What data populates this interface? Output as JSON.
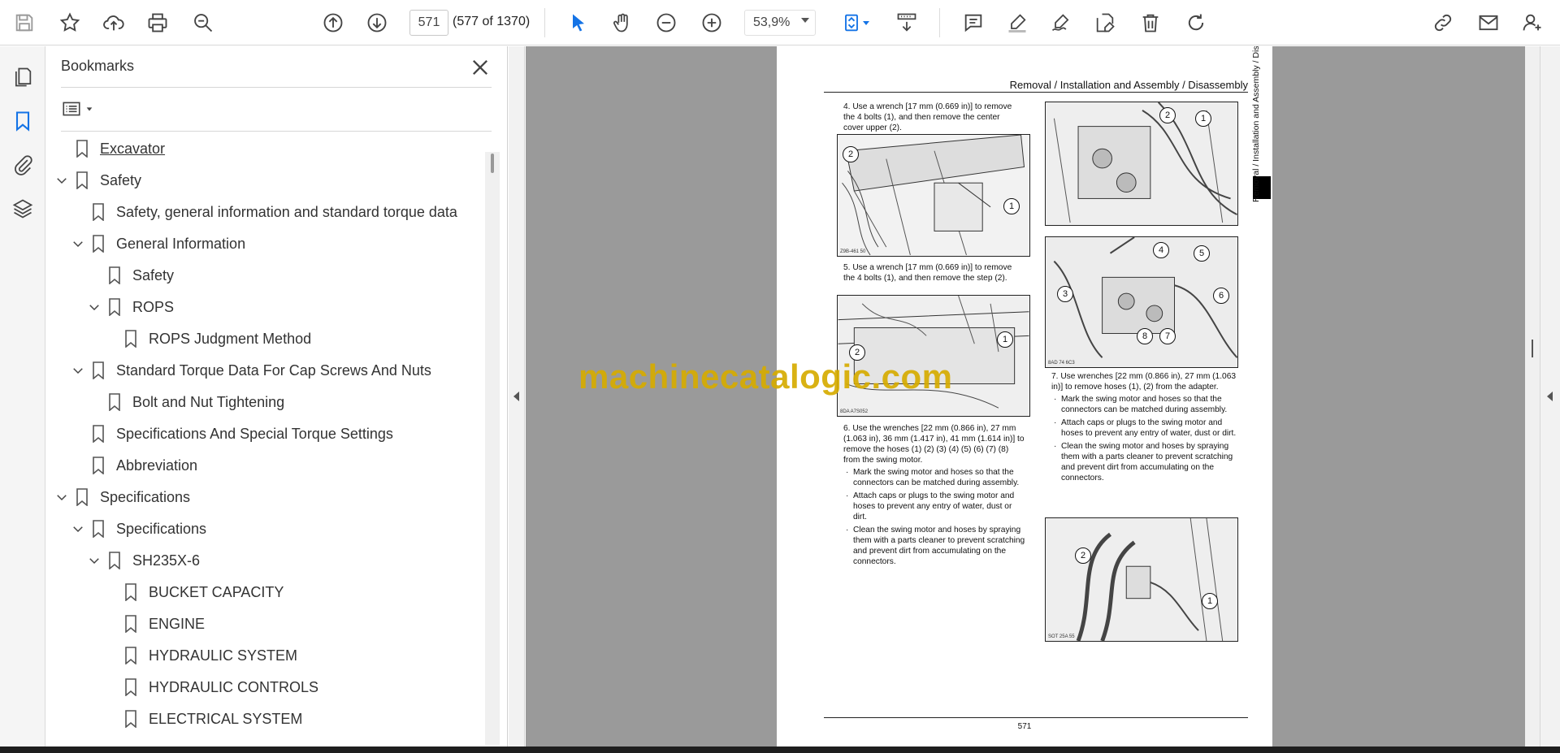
{
  "toolbar": {
    "page_current": "571",
    "page_count": "(577 of 1370)",
    "zoom": "53,9%"
  },
  "bookmarks": {
    "title": "Bookmarks",
    "items": [
      {
        "label": "Excavator",
        "level": 0,
        "expandable": false
      },
      {
        "label": "Safety",
        "level": 0,
        "expandable": true
      },
      {
        "label": "Safety, general information and standard torque data",
        "level": 1,
        "expandable": false
      },
      {
        "label": "General Information",
        "level": 1,
        "expandable": true
      },
      {
        "label": "Safety",
        "level": 2,
        "expandable": false
      },
      {
        "label": "ROPS",
        "level": 2,
        "expandable": true
      },
      {
        "label": "ROPS Judgment Method",
        "level": 3,
        "expandable": false
      },
      {
        "label": "Standard Torque Data For Cap Screws And Nuts",
        "level": 1,
        "expandable": true
      },
      {
        "label": "Bolt and Nut Tightening",
        "level": 2,
        "expandable": false
      },
      {
        "label": "Specifications And Special Torque Settings",
        "level": 1,
        "expandable": false
      },
      {
        "label": "Abbreviation",
        "level": 1,
        "expandable": false
      },
      {
        "label": "Specifications",
        "level": 0,
        "expandable": true
      },
      {
        "label": "Specifications",
        "level": 1,
        "expandable": true
      },
      {
        "label": "SH235X-6",
        "level": 2,
        "expandable": true
      },
      {
        "label": "BUCKET CAPACITY",
        "level": 3,
        "expandable": false
      },
      {
        "label": "ENGINE",
        "level": 3,
        "expandable": false
      },
      {
        "label": "HYDRAULIC SYSTEM",
        "level": 3,
        "expandable": false
      },
      {
        "label": "HYDRAULIC CONTROLS",
        "level": 3,
        "expandable": false
      },
      {
        "label": "ELECTRICAL SYSTEM",
        "level": 3,
        "expandable": false
      }
    ]
  },
  "document": {
    "header": "Removal / Installation and Assembly / Disassembly",
    "side_tab_text": "Removal / Installation and Assembly / Disassembly",
    "page_number": "571",
    "watermark": "machinecatalogic.com",
    "step4": "4. Use a wrench [17 mm (0.669 in)] to remove the 4 bolts (1), and then remove the center cover upper (2).",
    "step5": "5. Use a wrench [17 mm (0.669 in)] to remove the 4 bolts (1), and then remove the step (2).",
    "step6": "6. Use the wrenches [22 mm (0.866 in), 27 mm (1.063 in), 36 mm (1.417 in), 41 mm (1.614 in)] to remove the hoses (1) (2) (3) (4) (5) (6) (7) (8) from the swing motor.",
    "step6_bullets": [
      "Mark the swing motor and hoses so that the connectors can be matched during assembly.",
      "Attach caps or plugs to the swing motor and hoses to prevent any entry of water, dust or dirt.",
      "Clean the swing motor and hoses by spraying them with a parts cleaner to prevent scratching and prevent dirt from accumulating on the connectors."
    ],
    "step7": "7. Use wrenches [22 mm (0.866 in), 27 mm (1.063 in)] to remove hoses (1), (2) from the adapter.",
    "step7_bullets": [
      "Mark the swing motor and hoses so that the connectors can be matched during assembly.",
      "Attach caps or plugs to the swing motor and hoses to prevent any entry of water, dust or dirt.",
      "Clean the swing motor and hoses by spraying them with a parts cleaner to prevent scratching and prevent dirt from accumulating on the connectors."
    ],
    "fig_codes": [
      "Z9B-461 50",
      "8DA A7S052",
      "8AD 74 6C3",
      "SOT 25A 55"
    ]
  },
  "colors": {
    "accent_blue": "#1473e6",
    "watermark_gold": "#d6ab00",
    "doc_background": "#9a9a9a"
  }
}
